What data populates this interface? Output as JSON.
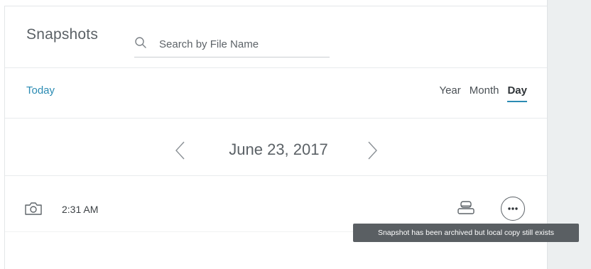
{
  "header": {
    "title": "Snapshots",
    "search": {
      "placeholder": "Search by File Name",
      "value": ""
    }
  },
  "filter": {
    "today_label": "Today",
    "ranges": [
      {
        "label": "Year",
        "active": false
      },
      {
        "label": "Month",
        "active": false
      },
      {
        "label": "Day",
        "active": true
      }
    ]
  },
  "date_nav": {
    "current_date": "June 23, 2017"
  },
  "snapshots": [
    {
      "time": "2:31 AM",
      "status_icon": "archive-icon",
      "menu_icon": "more-icon"
    }
  ],
  "tooltip": {
    "text": "Snapshot has been archived but local copy still exists"
  },
  "colors": {
    "accent": "#2b8bb3",
    "tooltip_bg": "#5a5f63",
    "sidebar_bg": "#eceff0"
  },
  "icons": [
    "search-icon",
    "chevron-left-icon",
    "chevron-right-icon",
    "camera-icon",
    "archive-icon",
    "more-icon"
  ]
}
